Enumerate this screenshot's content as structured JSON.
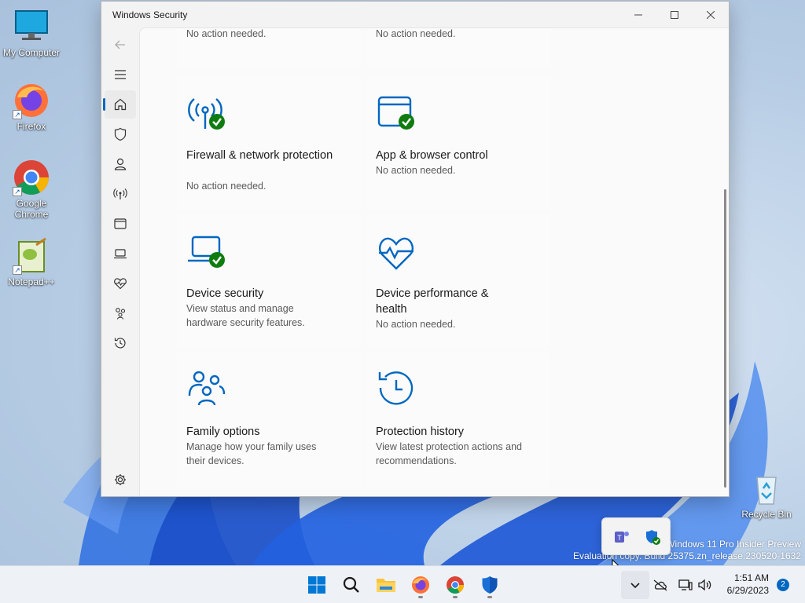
{
  "desktop": {
    "icons": [
      {
        "label": "My Computer"
      },
      {
        "label": "Firefox"
      },
      {
        "label": "Google Chrome"
      },
      {
        "label": "Notepad++"
      },
      {
        "label": "Recycle Bin"
      }
    ],
    "watermark_line1": "Windows 11 Pro Insider Preview",
    "watermark_line2": "Evaluation copy. Build 25375.zn_release.230520-1632"
  },
  "window": {
    "title": "Windows Security",
    "nav_icons": [
      "back-arrow-icon",
      "hamburger-icon",
      "home-icon",
      "shield-icon",
      "person-icon",
      "wifi-icon",
      "browser-icon",
      "laptop-icon",
      "heart-pulse-icon",
      "family-icon",
      "history-icon",
      "gear-icon"
    ],
    "accent": "#0067c0",
    "status_ok": "#107c10",
    "tiles": [
      {
        "desc": "No action needed."
      },
      {
        "desc": "No action needed."
      },
      {
        "name": "Firewall & network protection",
        "desc": "No action needed."
      },
      {
        "name": "App & browser control",
        "desc": "No action needed."
      },
      {
        "name": "Device security",
        "desc": "View status and manage hardware security features."
      },
      {
        "name": "Device performance & health",
        "desc": "No action needed."
      },
      {
        "name": "Family options",
        "desc": "Manage how your family uses their devices."
      },
      {
        "name": "Protection history",
        "desc": "View latest protection actions and recommendations."
      }
    ]
  },
  "taskbar": {
    "time": "1:51 AM",
    "date": "6/29/2023",
    "notification_count": "2"
  }
}
